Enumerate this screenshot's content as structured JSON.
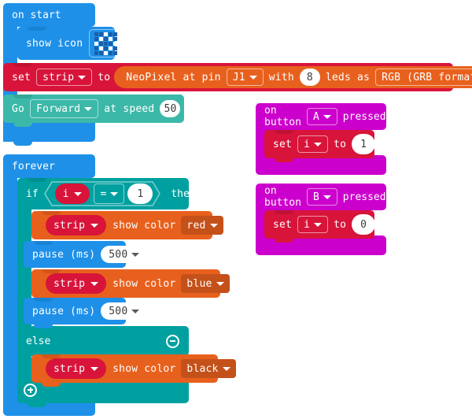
{
  "colors": {
    "loops_blue": "#1e90e8",
    "loops_blue_dark": "#1673bd",
    "basic_blue": "#1e90e8",
    "variables_red": "#d8143a",
    "variables_red_dark": "#b01030",
    "neopixel_orange": "#e8601d",
    "neopixel_orange_dark": "#c44d14",
    "logic_teal": "#00a0a0",
    "logic_teal_dark": "#008585",
    "servo_teal": "#3cb8a8",
    "input_magenta": "#cc00cc",
    "input_magenta_dark": "#a600a6",
    "led_off": "#1c5fa8",
    "led_on": "#ffffff",
    "white": "#ffffff"
  },
  "scripts": {
    "on_start": {
      "title": "on start",
      "blocks": {
        "show_icon": {
          "label": "show icon",
          "icon_name": "diamond-led-icon",
          "matrix": [
            [
              0,
              0,
              1,
              0,
              0
            ],
            [
              0,
              1,
              0,
              1,
              0
            ],
            [
              1,
              0,
              0,
              0,
              1
            ],
            [
              0,
              1,
              0,
              1,
              0
            ],
            [
              0,
              0,
              1,
              0,
              0
            ]
          ]
        },
        "set_strip": {
          "set_label": "set",
          "variable": "strip",
          "to_label": "to",
          "neopixel_label": "NeoPixel at pin",
          "pin": "J1",
          "with_label": "with",
          "leds_count": "8",
          "leds_label": "leds as",
          "format": "RGB (GRB format)"
        },
        "go_forward": {
          "go_label": "Go",
          "direction": "Forward",
          "speed_label": "at speed",
          "speed_value": "50",
          "percent_label": "%"
        }
      }
    },
    "forever": {
      "title": "forever",
      "if_block": {
        "if_label": "if",
        "left_operand": "i",
        "operator": "=",
        "right_operand": "1",
        "then_label": "then",
        "else_label": "else",
        "collapse_icon": "minus-circle-icon",
        "expand_icon": "plus-circle-icon"
      },
      "then_body": [
        {
          "kind": "show_color",
          "variable": "strip",
          "label": "show color",
          "color": "red"
        },
        {
          "kind": "pause",
          "label": "pause (ms)",
          "value": "500"
        },
        {
          "kind": "show_color",
          "variable": "strip",
          "label": "show color",
          "color": "blue"
        },
        {
          "kind": "pause",
          "label": "pause (ms)",
          "value": "500"
        }
      ],
      "else_body": [
        {
          "kind": "show_color",
          "variable": "strip",
          "label": "show color",
          "color": "black"
        }
      ]
    },
    "on_button_a": {
      "on_label": "on button",
      "button": "A",
      "pressed_label": "pressed",
      "set_label": "set",
      "variable": "i",
      "to_label": "to",
      "value": "1"
    },
    "on_button_b": {
      "on_label": "on button",
      "button": "B",
      "pressed_label": "pressed",
      "set_label": "set",
      "variable": "i",
      "to_label": "to",
      "value": "0"
    }
  }
}
